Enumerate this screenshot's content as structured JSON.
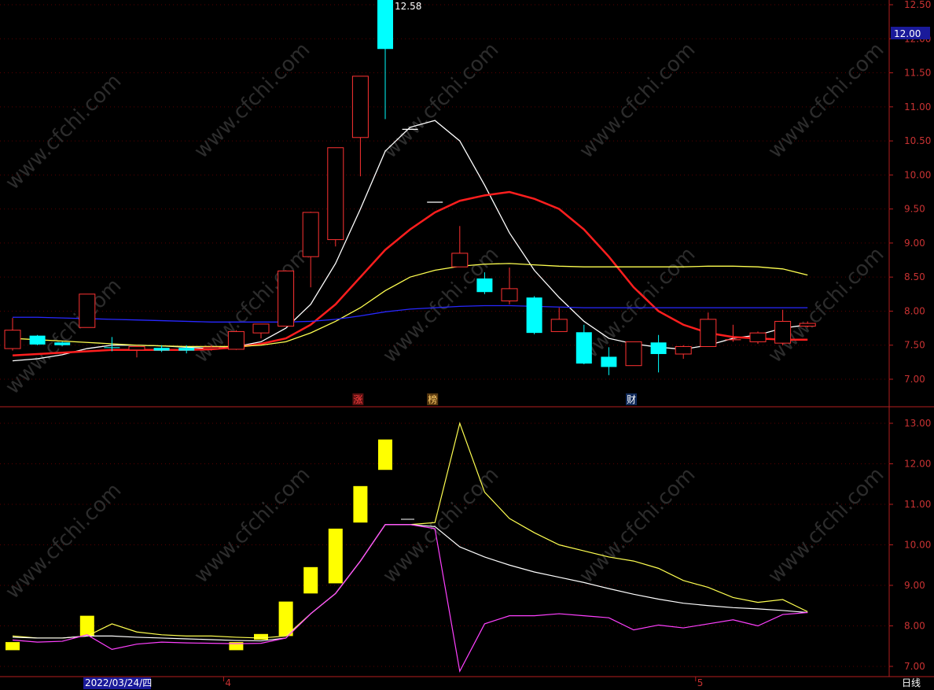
{
  "watermark": "www.cfchi.com",
  "period_label": "日线",
  "price_axis": {
    "ticks": [
      "12.50",
      "12.00",
      "11.50",
      "11.00",
      "10.50",
      "10.00",
      "9.50",
      "9.00",
      "8.50",
      "8.00",
      "7.50",
      "7.00"
    ],
    "current_price": "12.00"
  },
  "indicator_axis": {
    "ticks": [
      "13.00",
      "12.00",
      "11.00",
      "10.00",
      "9.00",
      "8.00",
      "7.00"
    ]
  },
  "high_label": "12.58",
  "event_markers": [
    {
      "label": "涨",
      "index": 14,
      "color": "#ff4040",
      "bg": "#5a1010"
    },
    {
      "label": "榜",
      "index": 17,
      "color": "#ffcc66",
      "bg": "#5a3a10"
    },
    {
      "label": "财",
      "index": 25,
      "color": "#ffffff",
      "bg": "#102a5a"
    }
  ],
  "date_axis": {
    "start_date": "2022/03/24/四",
    "month_labels": [
      {
        "label": "4",
        "index": 9
      },
      {
        "label": "5",
        "index": 28
      }
    ]
  },
  "colors": {
    "up": "#ff3232",
    "down": "#00ffff",
    "ma_white": "#ffffff",
    "ma_red": "#ff1e1e",
    "ma_yellow": "#ffff50",
    "ma_blue": "#2828ff",
    "ind_bar": "#ffff00",
    "ind_magenta": "#ff40ff"
  },
  "chart_data": [
    {
      "type": "candlestick",
      "ylim": [
        6.7,
        12.6
      ],
      "candles": [
        {
          "o": 7.45,
          "h": 7.9,
          "l": 7.42,
          "c": 7.72
        },
        {
          "o": 7.64,
          "h": 7.65,
          "l": 7.5,
          "c": 7.51
        },
        {
          "o": 7.54,
          "h": 7.55,
          "l": 7.49,
          "c": 7.5
        },
        {
          "o": 7.76,
          "h": 8.25,
          "l": 7.76,
          "c": 8.25
        },
        {
          "o": 7.47,
          "h": 7.62,
          "l": 7.41,
          "c": 7.46
        },
        {
          "o": 7.43,
          "h": 7.5,
          "l": 7.32,
          "c": 7.48
        },
        {
          "o": 7.46,
          "h": 7.5,
          "l": 7.4,
          "c": 7.42
        },
        {
          "o": 7.46,
          "h": 7.5,
          "l": 7.38,
          "c": 7.42
        },
        {
          "o": 7.45,
          "h": 7.5,
          "l": 7.42,
          "c": 7.47
        },
        {
          "o": 7.44,
          "h": 7.72,
          "l": 7.43,
          "c": 7.7
        },
        {
          "o": 7.68,
          "h": 7.8,
          "l": 7.6,
          "c": 7.81
        },
        {
          "o": 7.78,
          "h": 8.6,
          "l": 7.78,
          "c": 8.59
        },
        {
          "o": 8.8,
          "h": 9.46,
          "l": 8.35,
          "c": 9.45
        },
        {
          "o": 9.05,
          "h": 10.4,
          "l": 8.95,
          "c": 10.4
        },
        {
          "o": 10.55,
          "h": 11.45,
          "l": 9.98,
          "c": 11.45
        },
        {
          "o": 12.58,
          "h": 12.58,
          "l": 10.82,
          "c": 11.85
        },
        {
          "o": 10.67,
          "h": 10.67,
          "l": 10.67,
          "c": 10.67
        },
        {
          "o": 9.6,
          "h": 9.6,
          "l": 9.6,
          "c": 9.6
        },
        {
          "o": 8.65,
          "h": 9.25,
          "l": 8.65,
          "c": 8.85
        },
        {
          "o": 8.48,
          "h": 8.57,
          "l": 8.25,
          "c": 8.28
        },
        {
          "o": 8.15,
          "h": 8.64,
          "l": 8.1,
          "c": 8.33
        },
        {
          "o": 8.2,
          "h": 8.22,
          "l": 7.66,
          "c": 7.68
        },
        {
          "o": 7.7,
          "h": 8.05,
          "l": 7.7,
          "c": 7.88
        },
        {
          "o": 7.69,
          "h": 7.8,
          "l": 7.22,
          "c": 7.23
        },
        {
          "o": 7.33,
          "h": 7.47,
          "l": 7.06,
          "c": 7.18
        },
        {
          "o": 7.2,
          "h": 7.55,
          "l": 7.2,
          "c": 7.55
        },
        {
          "o": 7.54,
          "h": 7.65,
          "l": 7.1,
          "c": 7.37
        },
        {
          "o": 7.37,
          "h": 7.5,
          "l": 7.3,
          "c": 7.48
        },
        {
          "o": 7.48,
          "h": 7.98,
          "l": 7.48,
          "c": 7.88
        },
        {
          "o": 7.58,
          "h": 7.8,
          "l": 7.55,
          "c": 7.58
        },
        {
          "o": 7.55,
          "h": 7.7,
          "l": 7.52,
          "c": 7.68
        },
        {
          "o": 7.53,
          "h": 8.02,
          "l": 7.5,
          "c": 7.85
        },
        {
          "o": 7.78,
          "h": 7.85,
          "l": 7.76,
          "c": 7.82
        }
      ],
      "ma": [
        {
          "color": "#ffffff",
          "values": [
            7.27,
            7.3,
            7.36,
            7.45,
            7.5,
            7.5,
            7.49,
            7.47,
            7.45,
            7.48,
            7.55,
            7.75,
            8.1,
            8.7,
            9.5,
            10.35,
            10.7,
            10.8,
            10.5,
            9.85,
            9.15,
            8.6,
            8.2,
            7.85,
            7.6,
            7.52,
            7.47,
            7.44,
            7.5,
            7.6,
            7.65,
            7.75,
            7.8
          ]
        },
        {
          "color": "#ff1e1e",
          "values": [
            7.35,
            7.37,
            7.39,
            7.41,
            7.43,
            7.43,
            7.43,
            7.43,
            7.44,
            7.47,
            7.52,
            7.6,
            7.8,
            8.1,
            8.5,
            8.9,
            9.2,
            9.45,
            9.62,
            9.7,
            9.75,
            9.65,
            9.5,
            9.2,
            8.8,
            8.35,
            8.0,
            7.8,
            7.68,
            7.62,
            7.6,
            7.58,
            7.58
          ]
        },
        {
          "color": "#ffff50",
          "values": [
            7.6,
            7.58,
            7.56,
            7.54,
            7.52,
            7.5,
            7.49,
            7.48,
            7.48,
            7.48,
            7.5,
            7.55,
            7.68,
            7.85,
            8.05,
            8.3,
            8.5,
            8.6,
            8.66,
            8.69,
            8.7,
            8.68,
            8.66,
            8.65,
            8.65,
            8.65,
            8.65,
            8.65,
            8.66,
            8.66,
            8.65,
            8.62,
            8.53
          ]
        },
        {
          "color": "#2828ff",
          "values": [
            7.91,
            7.91,
            7.9,
            7.89,
            7.88,
            7.87,
            7.86,
            7.85,
            7.84,
            7.84,
            7.84,
            7.84,
            7.85,
            7.88,
            7.93,
            7.99,
            8.03,
            8.05,
            8.07,
            8.08,
            8.08,
            8.07,
            8.06,
            8.05,
            8.05,
            8.05,
            8.05,
            8.05,
            8.05,
            8.05,
            8.05,
            8.05,
            8.05
          ]
        }
      ]
    },
    {
      "type": "indicator",
      "ylim": [
        6.75,
        13.45
      ],
      "bars": [
        [
          7.6,
          7.4
        ],
        [
          null,
          null
        ],
        [
          null,
          null
        ],
        [
          7.75,
          8.25
        ],
        [
          null,
          null
        ],
        [
          null,
          null
        ],
        [
          null,
          null
        ],
        [
          null,
          null
        ],
        [
          null,
          null
        ],
        [
          7.6,
          7.4
        ],
        [
          7.66,
          7.8
        ],
        [
          7.75,
          8.6
        ],
        [
          8.8,
          9.45
        ],
        [
          9.05,
          10.4
        ],
        [
          10.55,
          11.45
        ],
        [
          11.85,
          12.6
        ],
        [
          null,
          null
        ],
        [
          null,
          null
        ],
        [
          null,
          null
        ],
        [
          null,
          null
        ],
        [
          null,
          null
        ],
        [
          null,
          null
        ],
        [
          null,
          null
        ],
        [
          null,
          null
        ],
        [
          null,
          null
        ],
        [
          null,
          null
        ],
        [
          null,
          null
        ],
        [
          null,
          null
        ],
        [
          null,
          null
        ],
        [
          null,
          null
        ],
        [
          null,
          null
        ],
        [
          null,
          null
        ],
        [
          null,
          null
        ]
      ],
      "lines": [
        {
          "color": "#ffff50",
          "values": [
            7.75,
            7.7,
            7.7,
            7.75,
            8.05,
            7.85,
            7.78,
            7.75,
            7.75,
            7.72,
            7.7,
            7.75,
            8.3,
            8.8,
            9.6,
            10.5,
            10.5,
            10.55,
            13.0,
            11.3,
            10.65,
            10.3,
            10.0,
            9.85,
            9.7,
            9.6,
            9.42,
            9.12,
            8.95,
            8.7,
            8.58,
            8.65,
            8.35
          ]
        },
        {
          "color": "#ffffff",
          "values": [
            7.72,
            7.7,
            7.7,
            7.75,
            7.75,
            7.72,
            7.7,
            7.68,
            7.66,
            7.64,
            7.63,
            7.7,
            8.3,
            8.8,
            9.6,
            10.5,
            10.5,
            10.45,
            9.95,
            9.7,
            9.5,
            9.33,
            9.2,
            9.07,
            8.92,
            8.78,
            8.66,
            8.56,
            8.5,
            8.45,
            8.42,
            8.38,
            8.33
          ]
        },
        {
          "color": "#ff40ff",
          "values": [
            7.65,
            7.6,
            7.62,
            7.78,
            7.42,
            7.55,
            7.6,
            7.58,
            7.57,
            7.56,
            7.57,
            7.7,
            8.3,
            8.8,
            9.6,
            10.5,
            10.5,
            10.4,
            6.88,
            8.05,
            8.25,
            8.25,
            8.3,
            8.25,
            8.2,
            7.9,
            8.02,
            7.95,
            8.05,
            8.15,
            8.0,
            8.28,
            8.33
          ]
        }
      ]
    }
  ]
}
